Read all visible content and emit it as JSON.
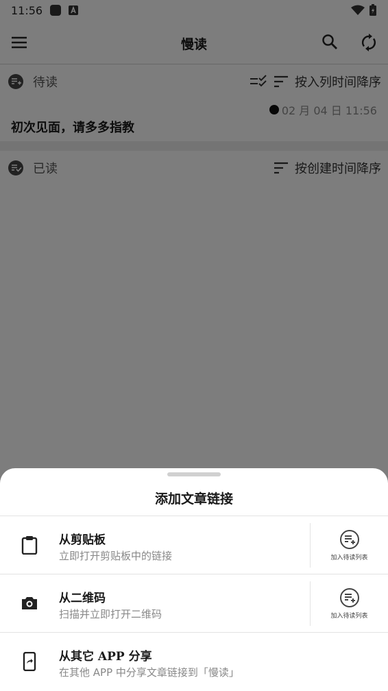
{
  "status": {
    "time": "11:56"
  },
  "appbar": {
    "title": "慢读"
  },
  "sections": {
    "unread": {
      "title": "待读",
      "sort_label": "按入列时间降序"
    },
    "read": {
      "title": "已读",
      "sort_label": "按创建时间降序"
    }
  },
  "articles": [
    {
      "date": "02 月 04 日 11:56",
      "title": "初次见面，请多多指教"
    }
  ],
  "sheet": {
    "title": "添加文章链接",
    "options": [
      {
        "title": "从剪贴板",
        "subtitle": "立即打开剪贴板中的链接",
        "add_label": "加入待读列表"
      },
      {
        "title": "从二维码",
        "subtitle": "扫描并立即打开二维码",
        "add_label": "加入待读列表"
      },
      {
        "title": "从其它 APP 分享",
        "subtitle": "在其他 APP 中分享文章链接到「慢读」"
      }
    ]
  }
}
